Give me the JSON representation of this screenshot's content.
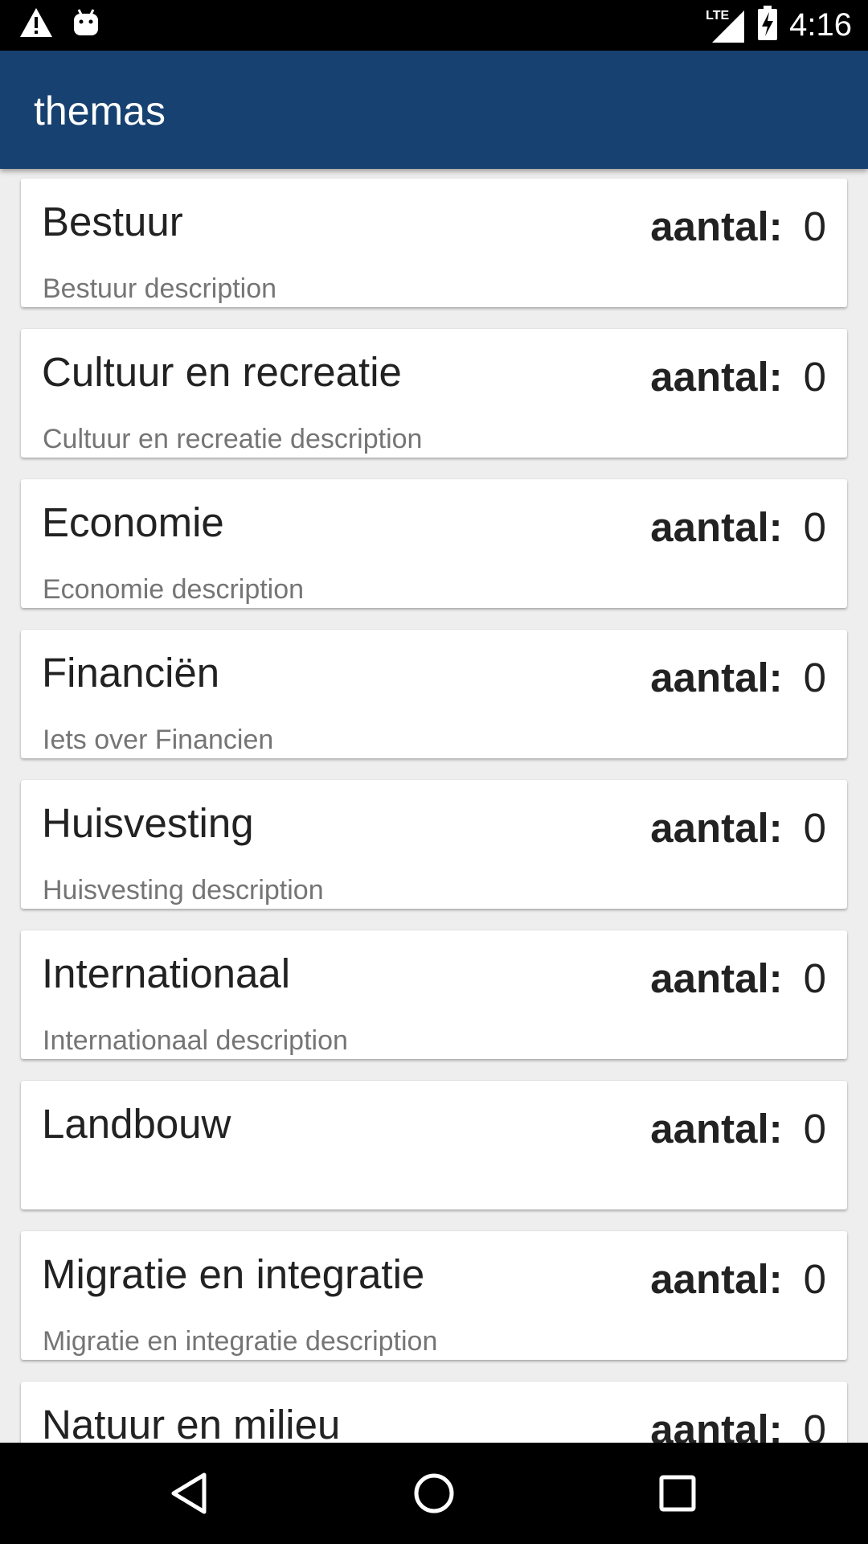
{
  "status_bar": {
    "time": "4:16",
    "network_label": "LTE",
    "icons": [
      "warning-icon",
      "android-icon",
      "signal-icon",
      "battery-charging-icon"
    ]
  },
  "app_bar": {
    "title": "themas"
  },
  "count_label": "aantal:",
  "themes": [
    {
      "title": "Bestuur",
      "description": "Bestuur description",
      "count": "0"
    },
    {
      "title": "Cultuur en recreatie",
      "description": "Cultuur en recreatie description",
      "count": "0"
    },
    {
      "title": "Economie",
      "description": "Economie description",
      "count": "0"
    },
    {
      "title": "Financiën",
      "description": "Iets over Financien",
      "count": "0"
    },
    {
      "title": "Huisvesting",
      "description": "Huisvesting description",
      "count": "0"
    },
    {
      "title": "Internationaal",
      "description": "Internationaal description",
      "count": "0"
    },
    {
      "title": "Landbouw",
      "description": "",
      "count": "0"
    },
    {
      "title": "Migratie en integratie",
      "description": "Migratie en integratie description",
      "count": "0"
    },
    {
      "title": "Natuur en milieu",
      "description": "",
      "count": "0"
    }
  ],
  "nav_bar": {
    "icons": [
      "back-icon",
      "home-icon",
      "recents-icon"
    ]
  }
}
